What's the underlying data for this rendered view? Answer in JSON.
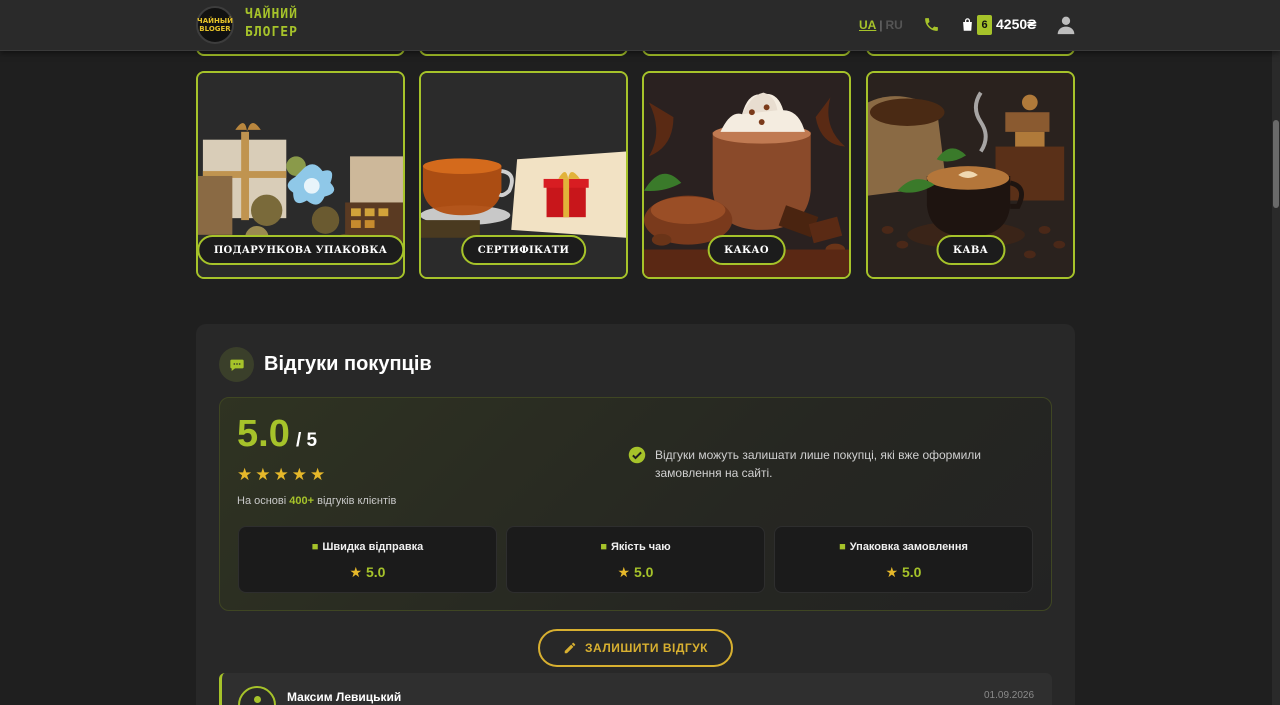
{
  "header": {
    "logo_badge": [
      "ЧАЙНЫЙ",
      "BLOGER"
    ],
    "logo_line1": "ЧАЙНИЙ",
    "logo_line2": "БЛОГЕР",
    "lang_ua": "UA",
    "lang_sep": "|",
    "lang_ru": "RU",
    "cart_count": "6",
    "cart_total": "4250₴"
  },
  "categories": [
    {
      "label": "ПОДАРУНКОВА УПАКОВКА",
      "icon": "gift-boxes-image"
    },
    {
      "label": "СЕРТИФІКАТИ",
      "icon": "tea-cup-gift-image"
    },
    {
      "label": "КАКАО",
      "icon": "cocoa-image"
    },
    {
      "label": "КАВА",
      "icon": "coffee-image"
    }
  ],
  "reviews": {
    "title": "Відгуки покупців",
    "score": "5.0",
    "score_max": "/ 5",
    "stars": "★★★★★",
    "based_prefix": "На основі ",
    "based_count": "400+",
    "based_suffix": " відгуків клієнтів",
    "notice": "Відгуки можуть залишати лише покупці, які вже оформили замовлення на сайті.",
    "metrics": [
      {
        "label": "Швидка відправка",
        "value": "5.0",
        "icon": "truck-icon"
      },
      {
        "label": "Якість чаю",
        "value": "5.0",
        "icon": "mug-icon"
      },
      {
        "label": "Упаковка замовлення",
        "value": "5.0",
        "icon": "box-icon"
      }
    ],
    "leave_button": "ЗАЛИШИТИ ВІДГУК",
    "first_review": {
      "name": "Максим Левицький",
      "date": "01.09.2026"
    }
  },
  "colors": {
    "accent": "#a6c32a",
    "star": "#e6b82a",
    "button": "#d8b030",
    "background": "#1f1f1f"
  }
}
